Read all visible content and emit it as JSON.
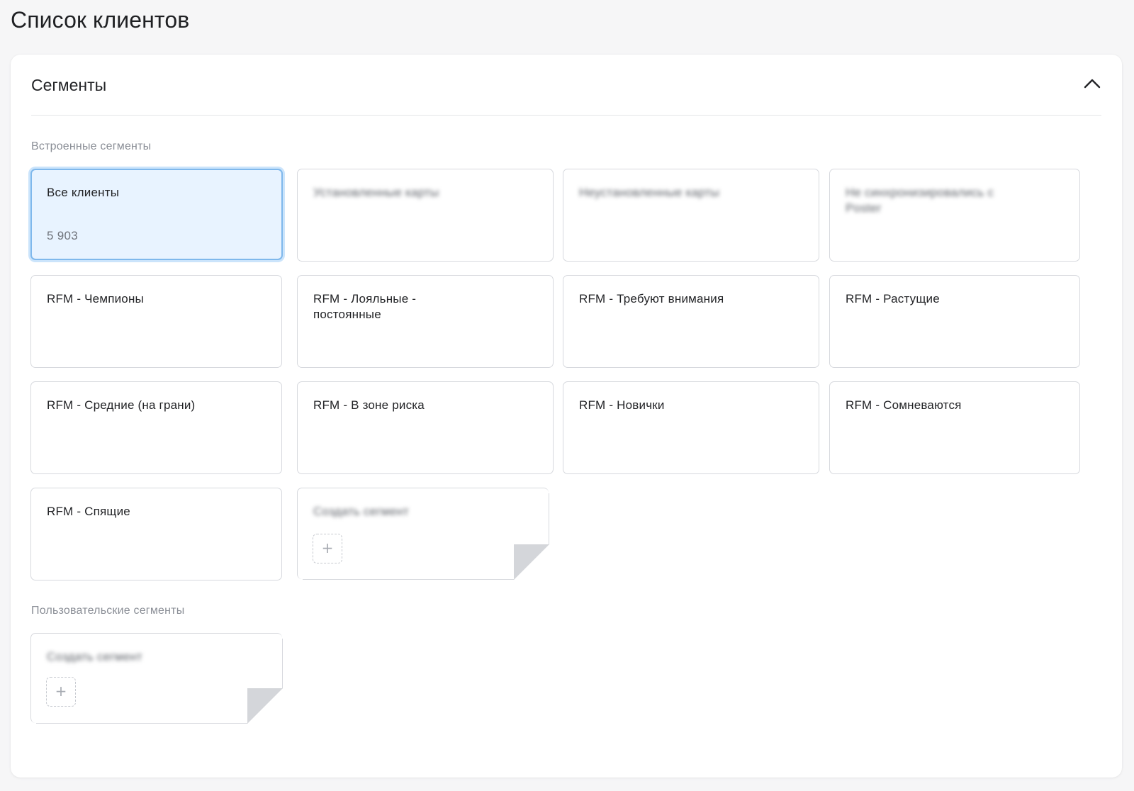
{
  "page": {
    "title": "Список клиентов"
  },
  "segments_panel": {
    "title": "Сегменты",
    "collapse_icon": "chevron-up-icon",
    "builtin_section_label": "Встроенные сегменты",
    "custom_section_label": "Пользовательские сегменты",
    "builtin_cards": [
      {
        "label": "Все клиенты",
        "count": "5 903",
        "selected": true
      },
      {
        "label": "Установленные карты",
        "blurred": true
      },
      {
        "label": "Неустановленные карты",
        "blurred": true
      },
      {
        "label": "Не синхронизировались с Poster",
        "blurred": true
      },
      {
        "label": "RFM - Чемпионы"
      },
      {
        "label": "RFM - Лояльные - постоянные"
      },
      {
        "label": "RFM - Требуют внимания"
      },
      {
        "label": "RFM - Растущие"
      },
      {
        "label": "RFM - Средние (на грани)"
      },
      {
        "label": "RFM - В зоне риска"
      },
      {
        "label": "RFM - Новички"
      },
      {
        "label": "RFM - Сомневаются"
      },
      {
        "label": "RFM - Спящие"
      }
    ],
    "builtin_create": {
      "label": "Создать сегмент",
      "icon": "plus-icon"
    },
    "custom_create": {
      "label": "Создать сегмент",
      "icon": "plus-icon"
    }
  },
  "colors": {
    "selected_bg": "#e8f3ff",
    "selected_border": "#7fb8ec",
    "card_border": "#d7d9de",
    "muted_text": "#8a8e96"
  }
}
